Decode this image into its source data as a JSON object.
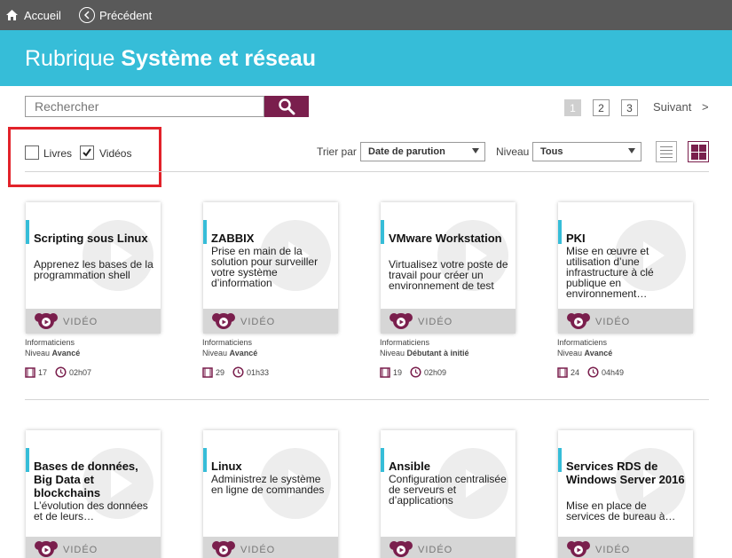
{
  "topbar": {
    "home_label": "Accueil",
    "prev_label": "Précédent"
  },
  "banner": {
    "prefix": "Rubrique",
    "subject": "Système et réseau"
  },
  "search": {
    "placeholder": "Rechercher"
  },
  "pagination": {
    "pages": [
      "1",
      "2",
      "3"
    ],
    "current": "1",
    "next_label": "Suivant",
    "next_glyph": ">"
  },
  "filters": {
    "books": {
      "label": "Livres",
      "checked": false
    },
    "videos": {
      "label": "Vidéos",
      "checked": true
    },
    "sort_label": "Trier par",
    "sort_value": "Date de parution",
    "level_label": "Niveau",
    "level_value": "Tous"
  },
  "colors": {
    "accent": "#36bdd8",
    "brand": "#7a1f4d",
    "topbar": "#595959",
    "highlight": "#e2222a"
  },
  "cards": [
    {
      "title": "Scripting sous Linux",
      "desc": "Apprenez les bases de la programmation shell",
      "type": "VIDÉO",
      "audience": "Informaticiens",
      "level_prefix": "Niveau",
      "level": "Avancé",
      "count": "17",
      "duration": "02h07"
    },
    {
      "title": "ZABBIX",
      "desc": "Prise en main de la solution pour surveiller votre système d’information",
      "type": "VIDÉO",
      "audience": "Informaticiens",
      "level_prefix": "Niveau",
      "level": "Avancé",
      "count": "29",
      "duration": "01h33"
    },
    {
      "title": "VMware Workstation",
      "desc": "Virtualisez votre poste de travail pour créer un environnement de test",
      "type": "VIDÉO",
      "audience": "Informaticiens",
      "level_prefix": "Niveau",
      "level": "Débutant à initié",
      "count": "19",
      "duration": "02h09"
    },
    {
      "title": "PKI",
      "desc": "Mise en œuvre et utilisation d’une infrastructure à clé publique en environnement…",
      "type": "VIDÉO",
      "audience": "Informaticiens",
      "level_prefix": "Niveau",
      "level": "Avancé",
      "count": "24",
      "duration": "04h49"
    },
    {
      "title": "Bases de données, Big Data et blockchains",
      "desc": "L’évolution des données et de leurs…",
      "type": "VIDÉO"
    },
    {
      "title": "Linux",
      "desc": "Administrez le système en ligne de commandes",
      "type": "VIDÉO"
    },
    {
      "title": "Ansible",
      "desc": "Configuration centralisée de serveurs et d’applications",
      "type": "VIDÉO"
    },
    {
      "title": "Services RDS de Windows Server 2016",
      "desc": "Mise en place de services de bureau à…",
      "type": "VIDÉO"
    }
  ]
}
